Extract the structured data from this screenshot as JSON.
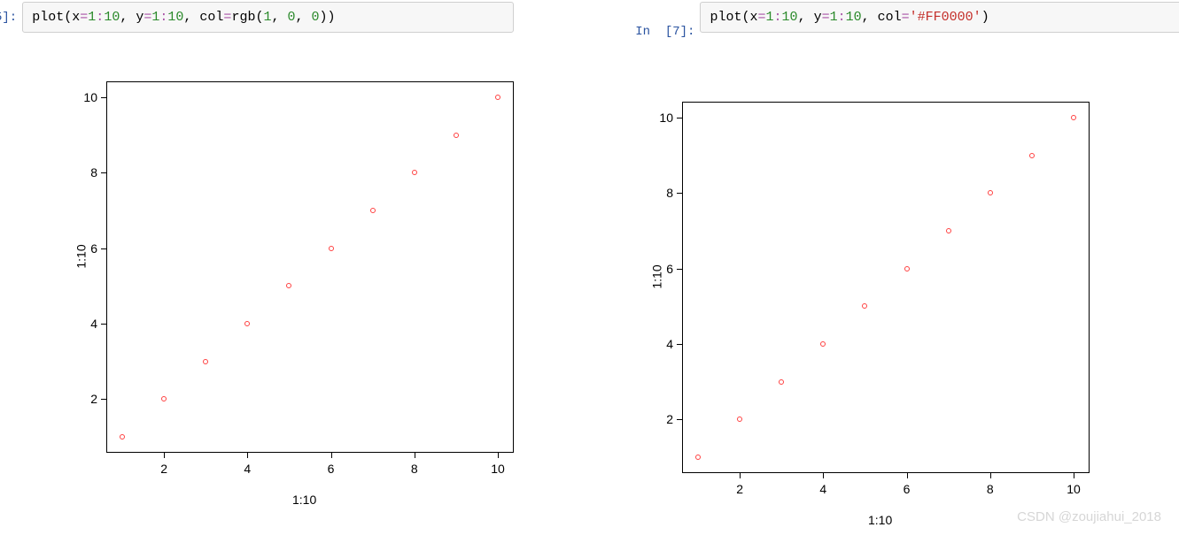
{
  "cells": [
    {
      "prompt_partial": "5]:",
      "code_tokens": [
        {
          "t": "plot",
          "c": "fn"
        },
        {
          "t": "(",
          "c": "fn"
        },
        {
          "t": "x",
          "c": "fn"
        },
        {
          "t": "=",
          "c": "op"
        },
        {
          "t": "1",
          "c": "num"
        },
        {
          "t": ":",
          "c": "op"
        },
        {
          "t": "10",
          "c": "num"
        },
        {
          "t": ", y",
          "c": "fn"
        },
        {
          "t": "=",
          "c": "op"
        },
        {
          "t": "1",
          "c": "num"
        },
        {
          "t": ":",
          "c": "op"
        },
        {
          "t": "10",
          "c": "num"
        },
        {
          "t": ", col",
          "c": "fn"
        },
        {
          "t": "=",
          "c": "op"
        },
        {
          "t": "rgb",
          "c": "fn"
        },
        {
          "t": "(",
          "c": "fn"
        },
        {
          "t": "1",
          "c": "num"
        },
        {
          "t": ", ",
          "c": "fn"
        },
        {
          "t": "0",
          "c": "num"
        },
        {
          "t": ", ",
          "c": "fn"
        },
        {
          "t": "0",
          "c": "num"
        },
        {
          "t": "))",
          "c": "fn"
        }
      ]
    },
    {
      "prompt_in": "In",
      "prompt_num": "[7]:",
      "code_tokens": [
        {
          "t": "plot",
          "c": "fn"
        },
        {
          "t": "(",
          "c": "fn"
        },
        {
          "t": "x",
          "c": "fn"
        },
        {
          "t": "=",
          "c": "op"
        },
        {
          "t": "1",
          "c": "num"
        },
        {
          "t": ":",
          "c": "op"
        },
        {
          "t": "10",
          "c": "num"
        },
        {
          "t": ", y",
          "c": "fn"
        },
        {
          "t": "=",
          "c": "op"
        },
        {
          "t": "1",
          "c": "num"
        },
        {
          "t": ":",
          "c": "op"
        },
        {
          "t": "10",
          "c": "num"
        },
        {
          "t": ", col",
          "c": "fn"
        },
        {
          "t": "=",
          "c": "op"
        },
        {
          "t": "'#FF0000'",
          "c": "str"
        },
        {
          "t": ")",
          "c": "fn"
        }
      ]
    }
  ],
  "chart_data": [
    {
      "type": "scatter",
      "x": [
        1,
        2,
        3,
        4,
        5,
        6,
        7,
        8,
        9,
        10
      ],
      "y": [
        1,
        2,
        3,
        4,
        5,
        6,
        7,
        8,
        9,
        10
      ],
      "xlabel": "1:10",
      "ylabel": "1:10",
      "point_color": "#ff0000",
      "xlim": [
        1,
        10
      ],
      "ylim": [
        1,
        10
      ],
      "xticks": [
        2,
        4,
        6,
        8,
        10
      ],
      "yticks": [
        2,
        4,
        6,
        8,
        10
      ]
    },
    {
      "type": "scatter",
      "x": [
        1,
        2,
        3,
        4,
        5,
        6,
        7,
        8,
        9,
        10
      ],
      "y": [
        1,
        2,
        3,
        4,
        5,
        6,
        7,
        8,
        9,
        10
      ],
      "xlabel": "1:10",
      "ylabel": "1:10",
      "point_color": "#ff0000",
      "xlim": [
        1,
        10
      ],
      "ylim": [
        1,
        10
      ],
      "xticks": [
        2,
        4,
        6,
        8,
        10
      ],
      "yticks": [
        2,
        4,
        6,
        8,
        10
      ]
    }
  ],
  "watermark": "CSDN @zoujiahui_2018"
}
